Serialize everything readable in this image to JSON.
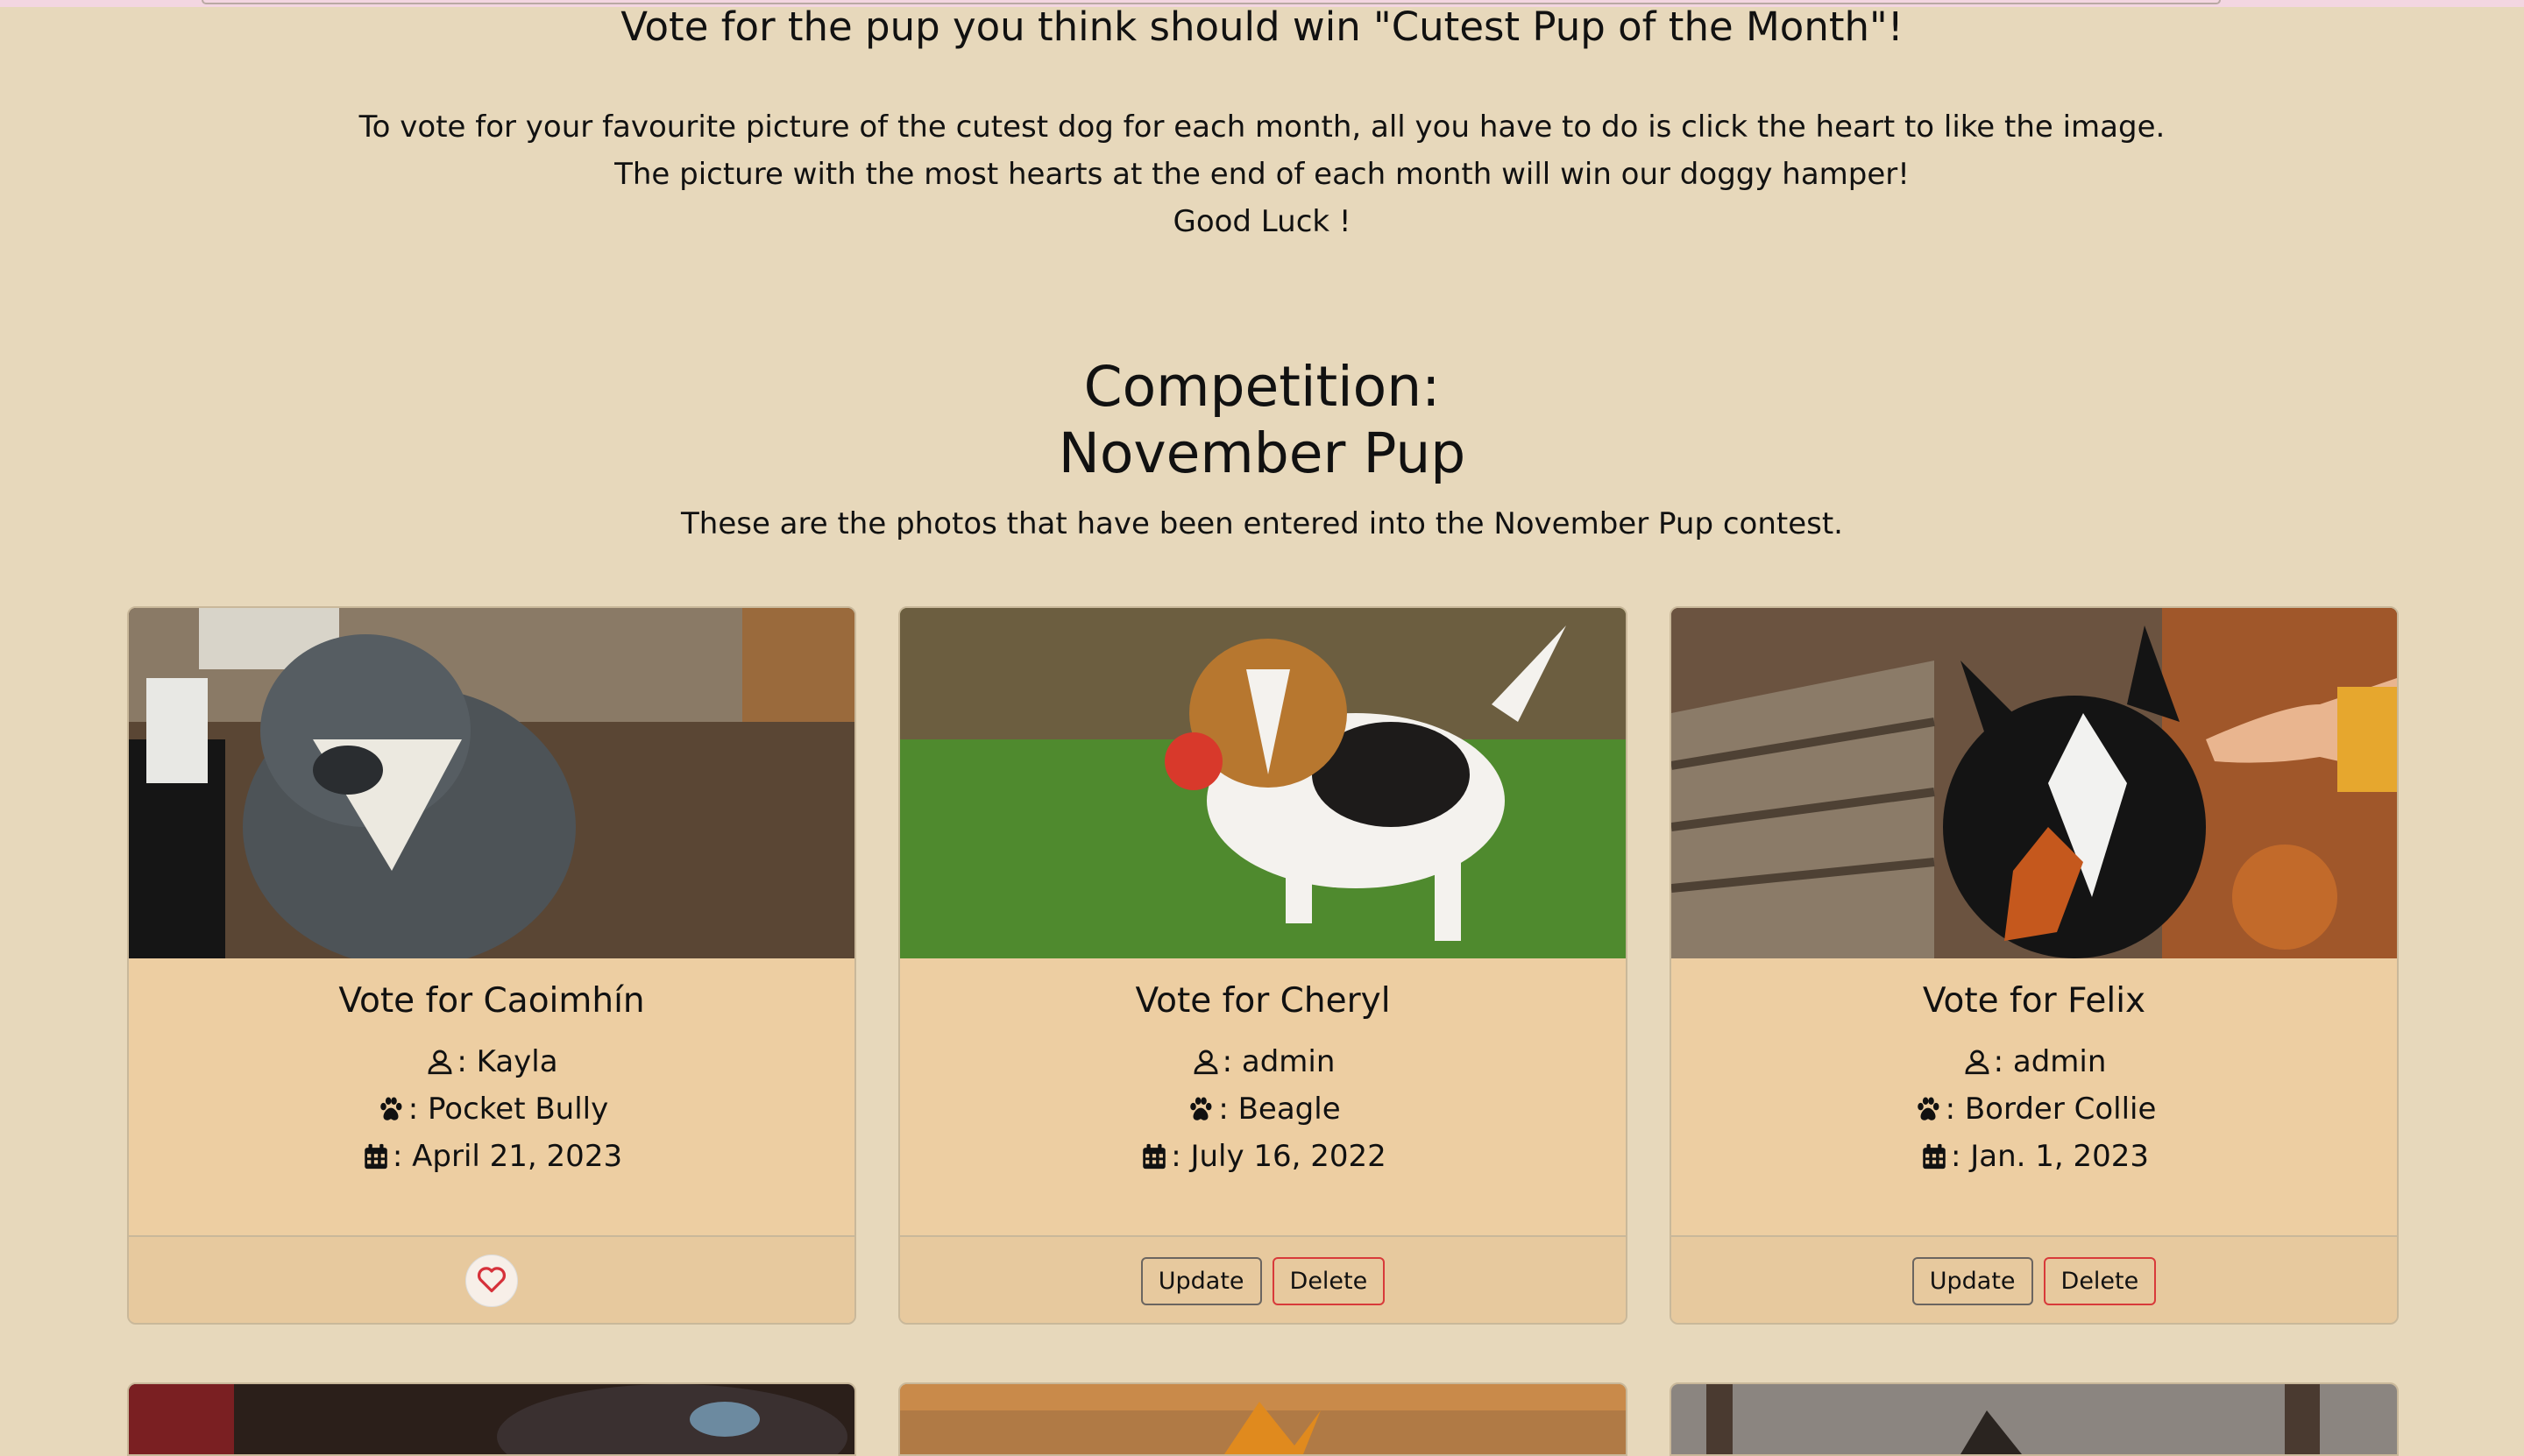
{
  "header": {
    "headline": "Vote for the pup you think should win \"Cutest Pup of the Month\"!",
    "intro_line1": "To vote for your favourite picture of the cutest dog for each month, all you have to do is click the heart to like the image.",
    "intro_line2": "The picture with the most hearts at the end of each month will win our doggy hamper!",
    "intro_line3": "Good Luck !"
  },
  "competition": {
    "label": "Competition:",
    "name": "November Pup",
    "description": "These are the photos that have been entered into the November Pup contest."
  },
  "entries": [
    {
      "title": "Vote for Caoimhín",
      "owner": ": Kayla",
      "breed": ": Pocket Bully",
      "date": ": April 21, 2023",
      "actions": "heart"
    },
    {
      "title": "Vote for Cheryl",
      "owner": ": admin",
      "breed": ": Beagle",
      "date": ": July 16, 2022",
      "update_label": "Update",
      "delete_label": "Delete"
    },
    {
      "title": "Vote for Felix",
      "owner": ": admin",
      "breed": ": Border Collie",
      "date": ": Jan. 1, 2023",
      "update_label": "Update",
      "delete_label": "Delete"
    }
  ],
  "icons": {
    "owner": "user-icon",
    "breed": "paw-icon",
    "date": "calendar-icon",
    "like": "heart-icon"
  },
  "colors": {
    "page_bg": "#e7d8bb",
    "card_body": "#edcea2",
    "delete_border": "#d83a3a",
    "heart": "#d6313a"
  }
}
